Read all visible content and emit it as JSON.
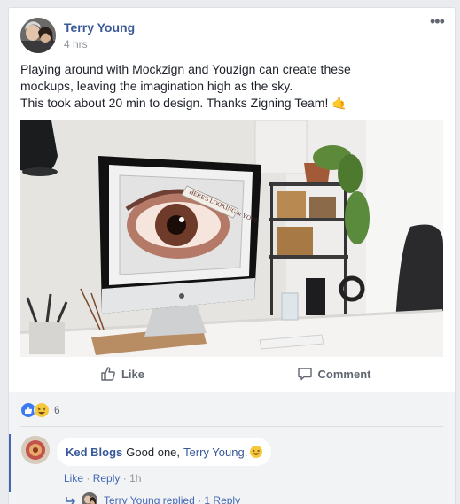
{
  "post": {
    "author": "Terry Young",
    "time": "4 hrs",
    "text_lines": [
      "Playing around with Mockzign and Youzign can create these",
      "mockups, leaving the imagination high as the sky.",
      "This took about 20 min to design. Thanks Zigning Team!"
    ],
    "hand_emoji": "🤙",
    "photo_caption": "HERE'S LOOKING at YOU!"
  },
  "actions": {
    "like_label": "Like",
    "comment_label": "Comment"
  },
  "reactions": {
    "count": "6",
    "types": [
      "like-icon",
      "haha-icon"
    ]
  },
  "comment": {
    "author": "Ked Blogs",
    "text": "Good one,",
    "mention": "Terry Young",
    "period": ".",
    "like_label": "Like",
    "separator": "·",
    "reply_label": "Reply",
    "time": "1h"
  },
  "reply_summary": {
    "text": "Terry Young replied · 1 Reply"
  },
  "colors": {
    "link": "#385898",
    "accent": "#4267b2",
    "meta": "#90949c"
  }
}
